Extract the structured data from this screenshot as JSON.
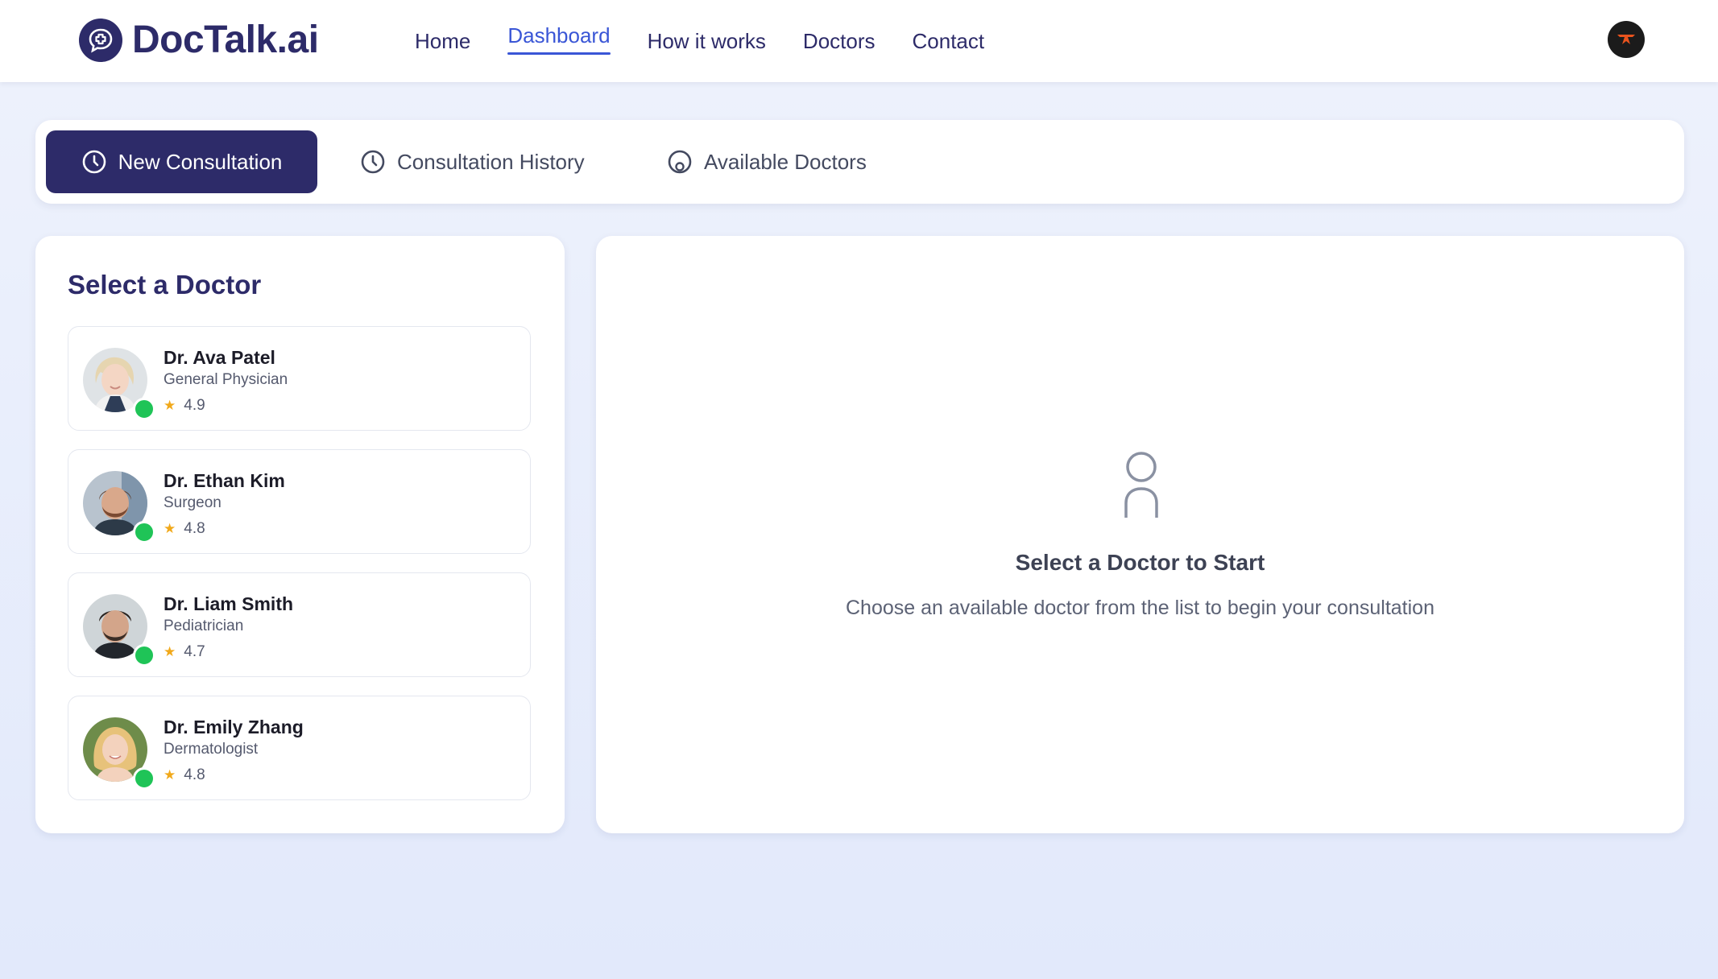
{
  "brand": {
    "name": "DocTalk.ai",
    "color": "#2d2b69"
  },
  "nav": {
    "links": [
      {
        "label": "Home",
        "active": false
      },
      {
        "label": "Dashboard",
        "active": true
      },
      {
        "label": "How it works",
        "active": false
      },
      {
        "label": "Doctors",
        "active": false
      },
      {
        "label": "Contact",
        "active": false
      }
    ],
    "active_color": "#3a56d6"
  },
  "tabs": [
    {
      "label": "New Consultation",
      "icon": "clock-icon",
      "active": true
    },
    {
      "label": "Consultation History",
      "icon": "clock-icon",
      "active": false
    },
    {
      "label": "Available Doctors",
      "icon": "user-circle-icon",
      "active": false
    }
  ],
  "doctor_panel": {
    "title": "Select a Doctor",
    "doctors": [
      {
        "name": "Dr. Ava Patel",
        "specialty": "General Physician",
        "rating": "4.9",
        "online": true
      },
      {
        "name": "Dr. Ethan Kim",
        "specialty": "Surgeon",
        "rating": "4.8",
        "online": true
      },
      {
        "name": "Dr. Liam Smith",
        "specialty": "Pediatrician",
        "rating": "4.7",
        "online": true
      },
      {
        "name": "Dr. Emily Zhang",
        "specialty": "Dermatologist",
        "rating": "4.8",
        "online": true
      }
    ],
    "star_icon": "star-icon",
    "online_color": "#1fc457"
  },
  "empty_state": {
    "icon": "user-outline-icon",
    "title": "Select a Doctor to Start",
    "subtitle": "Choose an available doctor from the list to begin your consultation"
  }
}
